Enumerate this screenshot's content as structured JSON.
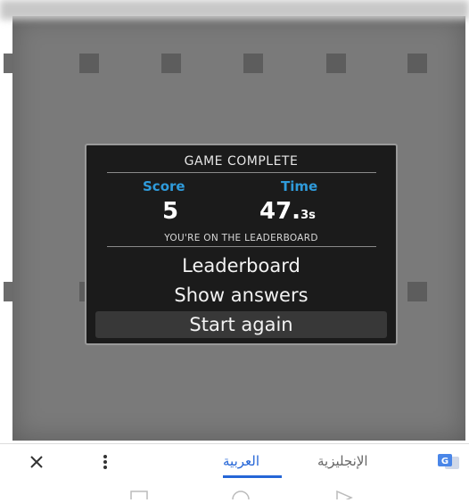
{
  "dialog": {
    "title": "GAME COMPLETE",
    "score_label": "Score",
    "time_label": "Time",
    "score_value": "5",
    "time_value": "47.",
    "time_unit": "3s",
    "leaderboard_note": "YOU'RE ON THE LEADERBOARD",
    "menu": [
      "Leaderboard",
      "Show answers",
      "Start again"
    ]
  },
  "translate_bar": {
    "tabs": [
      "العربية",
      "الإنجليزية"
    ],
    "selected_tab": "العربية",
    "icons": [
      "close-icon",
      "more-vert-icon",
      "google-translate-icon"
    ]
  },
  "navbar": {
    "icons": [
      "recents-icon",
      "home-icon",
      "back-icon"
    ]
  },
  "colors": {
    "accent_blue": "#2f9bdb",
    "translate_blue": "#2566d7",
    "dialog_bg": "#1b1b1b",
    "board_bg": "#7a7a7a"
  }
}
